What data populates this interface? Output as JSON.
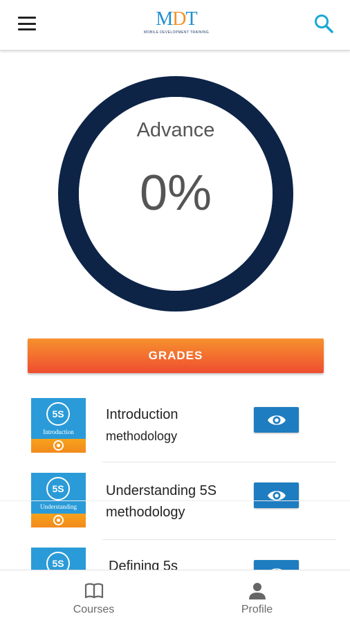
{
  "header": {
    "logo_text": "MDT",
    "logo_subtitle": "MOBILE DEVELOPMENT TRAINING",
    "menu_icon": "hamburger-menu-icon",
    "search_icon": "search-icon",
    "accent_color": "#1aa8d6"
  },
  "progress": {
    "label": "Advance",
    "value_text": "0%",
    "value": 0,
    "ring_color": "#0d2447"
  },
  "grades_button": {
    "label": "GRADES",
    "gradient": [
      "#f6912e",
      "#ee4d30"
    ]
  },
  "courses": [
    {
      "thumb_badge": "5S",
      "thumb_caption": "Introduction",
      "title_line1": "Introduction",
      "title_line2": "methodology",
      "view_icon": "eye-icon"
    },
    {
      "thumb_badge": "5S",
      "thumb_caption": "Understanding",
      "title_line1": "Understanding 5S",
      "title_line2": "methodology",
      "view_icon": "eye-icon"
    },
    {
      "thumb_badge": "5S",
      "thumb_caption": "",
      "title_line1": "Defining 5s",
      "title_line2": "",
      "view_icon": "eye-icon"
    }
  ],
  "bottom_nav": {
    "items": [
      {
        "label": "Courses",
        "icon": "book-icon"
      },
      {
        "label": "Profile",
        "icon": "person-icon"
      }
    ]
  }
}
